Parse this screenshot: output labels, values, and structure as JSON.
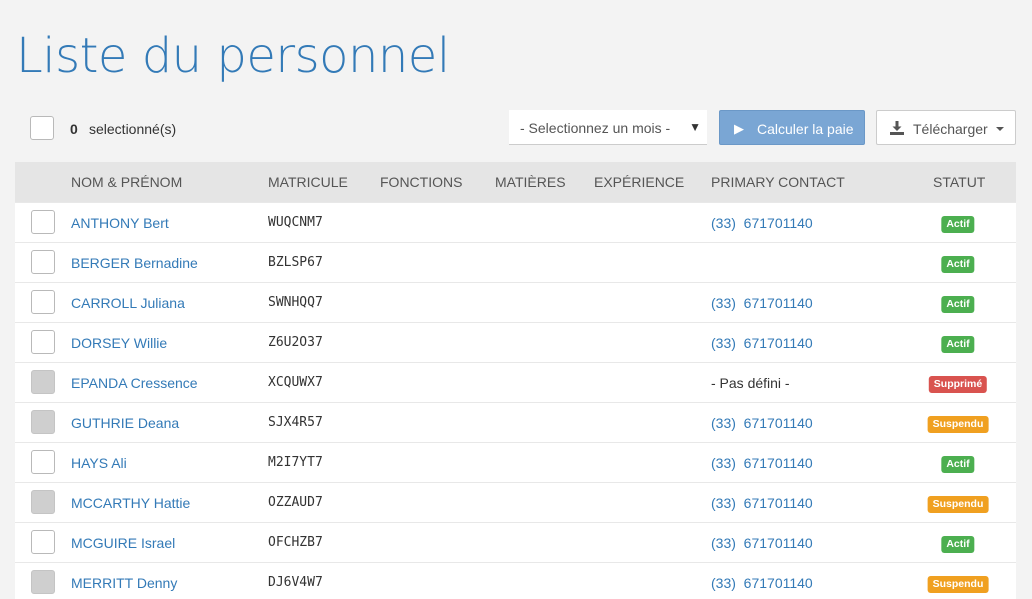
{
  "page": {
    "title": "Liste du personnel"
  },
  "toolbar": {
    "selected_count": "0",
    "selected_label": "selectionné(s)",
    "month_select": "- Selectionnez un mois -",
    "compute_label": "Calculer la paie",
    "download_label": "Télécharger"
  },
  "table": {
    "headers": {
      "name": "NOM & PRÉNOM",
      "matricule": "MATRICULE",
      "fonctions": "FONCTIONS",
      "matieres": "MATIÈRES",
      "experience": "EXPÉRIENCE",
      "contact": "PRIMARY CONTACT",
      "statut": "STATUT"
    },
    "rows": [
      {
        "name": "ANTHONY Bert",
        "matricule": "WUQCNM7",
        "contact": "(33)  671701140",
        "status": "Actif",
        "status_type": "actif",
        "checkbox": "enabled"
      },
      {
        "name": "BERGER Bernadine",
        "matricule": "BZLSP67",
        "contact": "",
        "status": "Actif",
        "status_type": "actif",
        "checkbox": "enabled"
      },
      {
        "name": "CARROLL Juliana",
        "matricule": "SWNHQQ7",
        "contact": "(33)  671701140",
        "status": "Actif",
        "status_type": "actif",
        "checkbox": "enabled"
      },
      {
        "name": "DORSEY Willie",
        "matricule": "Z6U2O37",
        "contact": "(33)  671701140",
        "status": "Actif",
        "status_type": "actif",
        "checkbox": "enabled"
      },
      {
        "name": "EPANDA Cressence",
        "matricule": "XCQUWX7",
        "contact": "- Pas défini -",
        "status": "Supprimé",
        "status_type": "supprime",
        "checkbox": "disabled"
      },
      {
        "name": "GUTHRIE Deana",
        "matricule": "SJX4R57",
        "contact": "(33)  671701140",
        "status": "Suspendu",
        "status_type": "suspendu",
        "checkbox": "disabled"
      },
      {
        "name": "HAYS Ali",
        "matricule": "M2I7YT7",
        "contact": "(33)  671701140",
        "status": "Actif",
        "status_type": "actif",
        "checkbox": "enabled"
      },
      {
        "name": "MCCARTHY Hattie",
        "matricule": "OZZAUD7",
        "contact": "(33)  671701140",
        "status": "Suspendu",
        "status_type": "suspendu",
        "checkbox": "disabled"
      },
      {
        "name": "MCGUIRE Israel",
        "matricule": "OFCHZB7",
        "contact": "(33)  671701140",
        "status": "Actif",
        "status_type": "actif",
        "checkbox": "enabled"
      },
      {
        "name": "MERRITT Denny",
        "matricule": "DJ6V4W7",
        "contact": "(33)  671701140",
        "status": "Suspendu",
        "status_type": "suspendu",
        "checkbox": "disabled"
      }
    ]
  },
  "colors": {
    "accent": "#337ab7",
    "primary_button": "#7aa6d4",
    "actif": "#4caf50",
    "supprime": "#d9534f",
    "suspendu": "#f0a020"
  }
}
